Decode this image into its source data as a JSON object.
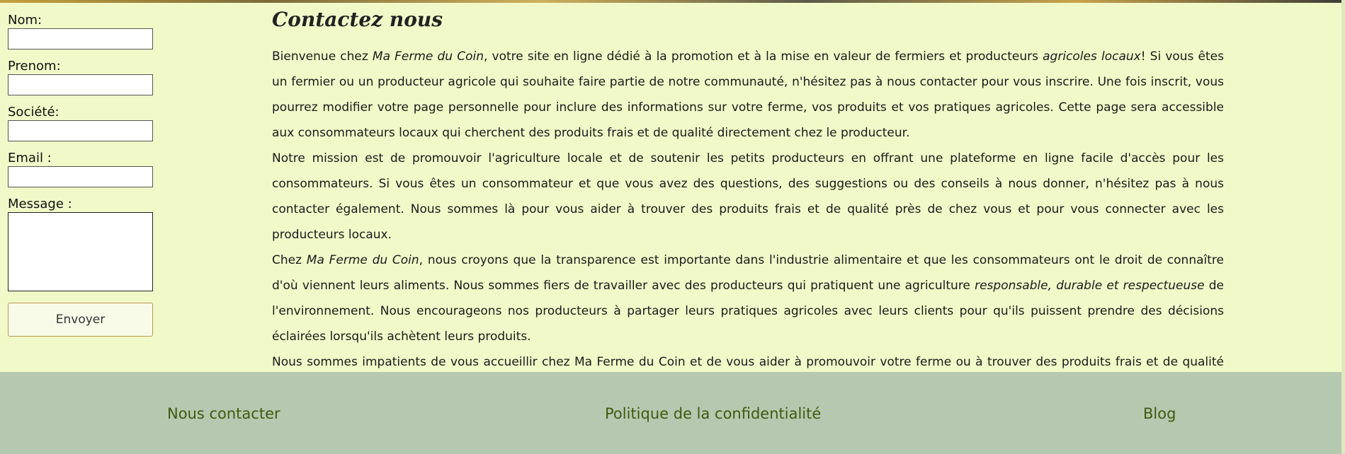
{
  "form": {
    "nom_label": "Nom:",
    "prenom_label": "Prenom:",
    "societe_label": "Société:",
    "email_label": "Email :",
    "message_label": "Message :",
    "submit_label": "Envoyer"
  },
  "main": {
    "title": "Contactez nous",
    "p1": {
      "a": "Bienvenue chez ",
      "b": "Ma Ferme du Coin",
      "c": ", votre site en ligne dédié à la promotion et à la mise en valeur de fermiers et producteurs ",
      "d": "agricoles locaux",
      "e": "! Si vous êtes un fermier ou un producteur agricole qui souhaite faire partie de notre communauté, n'hésitez pas à nous contacter pour vous inscrire. Une fois inscrit, vous pourrez modifier votre page personnelle pour inclure des informations sur votre ferme, vos produits et vos pratiques agricoles. Cette page sera accessible aux consommateurs locaux qui cherchent des produits frais et de qualité directement chez le producteur."
    },
    "p2": "Notre mission est de promouvoir l'agriculture locale et de soutenir les petits producteurs en offrant une plateforme en ligne facile d'accès pour les consommateurs. Si vous êtes un consommateur et que vous avez des questions, des suggestions ou des conseils à nous donner, n'hésitez pas à nous contacter également. Nous sommes là pour vous aider à trouver des produits frais et de qualité près de chez vous et pour vous connecter avec les producteurs locaux.",
    "p3": {
      "a": "Chez ",
      "b": "Ma Ferme du Coin",
      "c": ", nous croyons que la transparence est importante dans l'industrie alimentaire et que les consommateurs ont le droit de connaître d'où viennent leurs aliments. Nous sommes fiers de travailler avec des producteurs qui pratiquent une agriculture ",
      "d": "responsable, durable et respectueuse",
      "e": " de l'environnement. Nous encourageons nos producteurs à partager leurs pratiques agricoles avec leurs clients pour qu'ils puissent prendre des décisions éclairées lorsqu'ils achètent leurs produits."
    },
    "p4": "Nous sommes impatients de vous accueillir chez Ma Ferme du Coin et de vous aider à promouvoir votre ferme ou à trouver des produits frais et de qualité près de chez vous. N'hésitez pas à nous contacter pour toute question ou demande d'information."
  },
  "footer": {
    "links": [
      "Nous contacter",
      "Politique de la confidentialité",
      "Blog"
    ]
  },
  "colors": {
    "background": "#f1f9c9",
    "footer_background": "#b4c9b0",
    "footer_link": "#3f5a0d"
  }
}
